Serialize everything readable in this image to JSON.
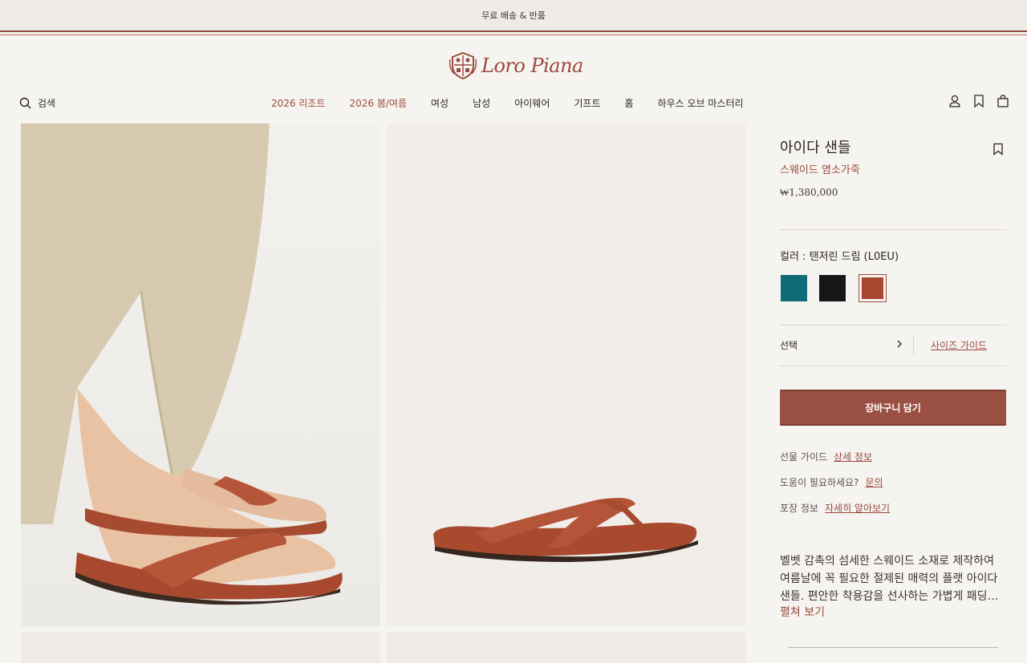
{
  "announcement": "무료 배송 & 반품",
  "brand": {
    "logo_text": "Loro Piana",
    "accent": "#9b4b3f"
  },
  "header": {
    "search_label": "검색",
    "nav": [
      {
        "label": "2026 리조트"
      },
      {
        "label": "2026 봄/여름"
      },
      {
        "label": "여성"
      },
      {
        "label": "남성"
      },
      {
        "label": "아이웨어"
      },
      {
        "label": "기프트"
      },
      {
        "label": "홈"
      },
      {
        "label": "하우스 오브 마스터리"
      }
    ],
    "icons": [
      "user-icon",
      "bookmark-icon",
      "shopping-bag-icon"
    ]
  },
  "product": {
    "title": "아이다 샌들",
    "material": "스웨이드 염소가죽",
    "price": "₩1,380,000",
    "color_label": "컬러 : 탠저린 드림 (L0EU)",
    "swatches": [
      {
        "name": "teal",
        "color": "#0f6b78"
      },
      {
        "name": "black",
        "color": "#161616"
      },
      {
        "name": "tangerine",
        "color": "#a8472f",
        "selected": true
      }
    ],
    "size_select": "선택",
    "size_guide": "사이즈 가이드",
    "add_to_cart": "장바구니 담기",
    "info": [
      {
        "label": "선물 가이드",
        "link": "상세 정보"
      },
      {
        "label": "도움이 필요하세요?",
        "link": "문의"
      },
      {
        "label": "포장 정보",
        "link": "자세히 알아보기"
      }
    ],
    "description": "벨벳 감촉의 섬세한 스웨이드 소재로 제작하여 여름날에 꼭 필요한 절제된 매력의 플랫 아이다 샌들. 편안한 착용감을 선사하는 가볍게 패딩…",
    "read_more": "펼쳐 보기"
  }
}
